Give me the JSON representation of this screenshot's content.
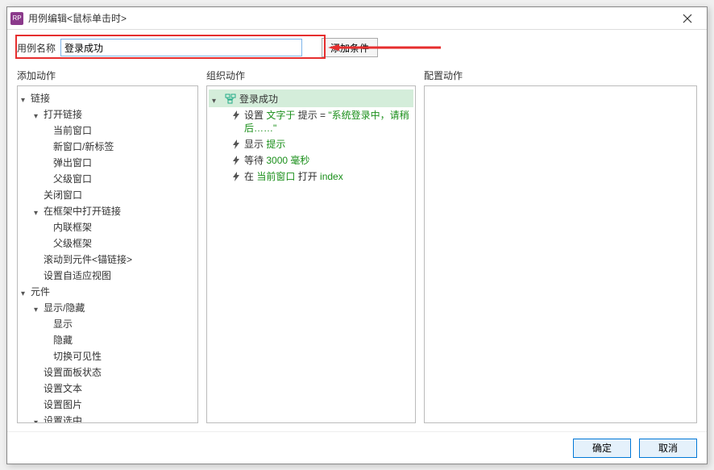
{
  "titlebar": {
    "icon_text": "RP",
    "title": "用例编辑<鼠标单击时>"
  },
  "top": {
    "name_label": "用例名称",
    "name_value": "登录成功",
    "cond_btn": "添加条件"
  },
  "headers": {
    "add": "添加动作",
    "org": "组织动作",
    "cfg": "配置动作"
  },
  "tree": {
    "links": {
      "label": "链接",
      "open_link": "打开链接",
      "current_win": "当前窗口",
      "new_win": "新窗口/新标签",
      "popup_win": "弹出窗口",
      "parent_win": "父级窗口",
      "close_win": "关闭窗口",
      "open_in_frame": "在框架中打开链接",
      "inline_frame": "内联框架",
      "parent_frame": "父级框架",
      "scroll_anchor": "滚动到元件<锚链接>",
      "set_adaptive": "设置自适应视图"
    },
    "widgets": {
      "label": "元件",
      "show_hide": "显示/隐藏",
      "show": "显示",
      "hide": "隐藏",
      "toggle_vis": "切换可见性",
      "panel_state": "设置面板状态",
      "set_text": "设置文本",
      "set_image": "设置图片",
      "set_selected": "设置选中"
    }
  },
  "case": {
    "name": "登录成功",
    "actions": {
      "a1_pre": "设置 ",
      "a1_g1": "文字于",
      "a1_mid": " 提示 = ",
      "a1_g2": "\"系统登录中，请稍后……\"",
      "a2_pre": "显示 ",
      "a2_g": "提示",
      "a3_pre": "等待 ",
      "a3_g": "3000 毫秒",
      "a4_pre": "在 ",
      "a4_g1": "当前窗口",
      "a4_mid": " 打开 ",
      "a4_g2": "index"
    }
  },
  "footer": {
    "ok": "确定",
    "cancel": "取消"
  }
}
